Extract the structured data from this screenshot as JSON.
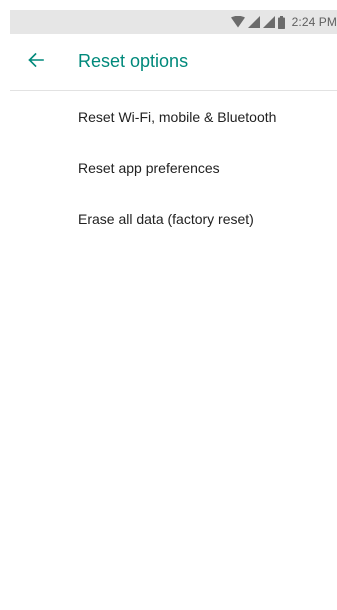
{
  "status_bar": {
    "time": "2:24 PM",
    "icons": [
      "wifi-icon",
      "cell-signal-icon",
      "cell-signal-icon",
      "battery-icon"
    ]
  },
  "app_bar": {
    "title": "Reset options",
    "back_icon": "arrow-left-icon"
  },
  "menu": {
    "items": [
      {
        "label": "Reset Wi-Fi, mobile & Bluetooth"
      },
      {
        "label": "Reset app preferences"
      },
      {
        "label": "Erase all data (factory reset)"
      }
    ]
  },
  "colors": {
    "accent": "#00897b",
    "status_bar_bg": "#e6e6e6",
    "text_primary": "#212121"
  }
}
